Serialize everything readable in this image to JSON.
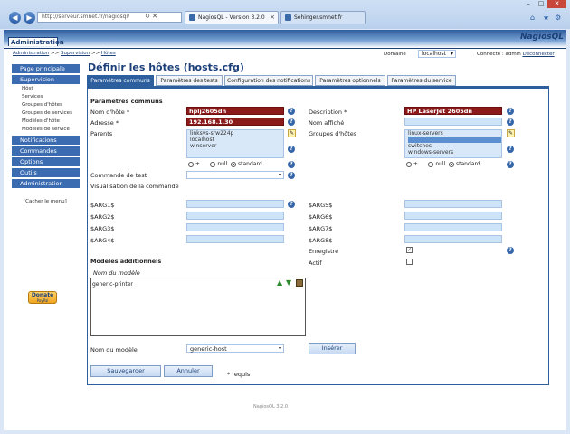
{
  "browser": {
    "address": "http://serveur.smnet.fr/nagiosql/",
    "tabs": [
      {
        "label": "NagiosQL - Version 3.2.0"
      },
      {
        "label": "Sehinger.smnet.fr"
      }
    ]
  },
  "header": {
    "section": "Administration",
    "logo": "NagiosQL"
  },
  "breadcrumb": {
    "items": [
      "Administration",
      "Supervision",
      "Hôtes"
    ],
    "separator": ">>"
  },
  "domain": {
    "label": "Domaine",
    "value": "localhost"
  },
  "session": {
    "text": "Connecté : admin",
    "logout": "Déconnecter"
  },
  "sidebar": {
    "sections": [
      {
        "label": "Page principale"
      },
      {
        "label": "Supervision"
      },
      {
        "label": "Notifications"
      },
      {
        "label": "Commandes"
      },
      {
        "label": "Options"
      },
      {
        "label": "Outils"
      },
      {
        "label": "Administration"
      }
    ],
    "items": [
      "Hôst",
      "Services",
      "Groupes d'hôtes",
      "Groupes de services",
      "Modèles d'hôte",
      "Modèles de service"
    ],
    "hide": "[Cacher le menu]",
    "donate": "Donate",
    "donate_sub": "PayPal"
  },
  "page": {
    "title": "Définir les hôtes (hosts.cfg)"
  },
  "tabs": [
    {
      "label": "Paramètres communs"
    },
    {
      "label": "Paramètres des tests"
    },
    {
      "label": "Configuration des notifications"
    },
    {
      "label": "Paramètres optionnels"
    },
    {
      "label": "Paramètres du service"
    }
  ],
  "form": {
    "section_common": "Paramètres communs",
    "hostname_label": "Nom d'hôte *",
    "hostname": "hplj2605dn",
    "address_label": "Adresse *",
    "address": "192.168.1.30",
    "parents_label": "Parents",
    "parents": [
      "linksys-srw224p",
      "localhost",
      "winserver"
    ],
    "description_label": "Description *",
    "description": "HP LaserJet 2605dn",
    "display_label": "Nom affiché",
    "hostgroups_label": "Groupes d'hôtes",
    "hostgroups": [
      "linux-servers",
      "network-printers",
      "switches",
      "windows-servers"
    ],
    "radio": {
      "plus": "+",
      "null": "null",
      "standard": "standard"
    },
    "check_command_label": "Commande de test",
    "view_command_label": "Visualisation de la commande",
    "args_left": [
      "$ARG1$",
      "$ARG2$",
      "$ARG3$",
      "$ARG4$"
    ],
    "args_right": [
      "$ARG5$",
      "$ARG6$",
      "$ARG7$",
      "$ARG8$"
    ],
    "registered_label": "Enregistré",
    "active_label": "Actif",
    "templates_section": "Modèles additionnels",
    "template_col": "Nom du modèle",
    "templates": [
      "generic-printer"
    ],
    "template_name_label": "Nom du modèle",
    "template_select": "generic-host",
    "insert": "Insérer",
    "save": "Sauvegarder",
    "cancel": "Annuler",
    "required": "* requis"
  },
  "footer": "NagiosQL 3.2.0"
}
